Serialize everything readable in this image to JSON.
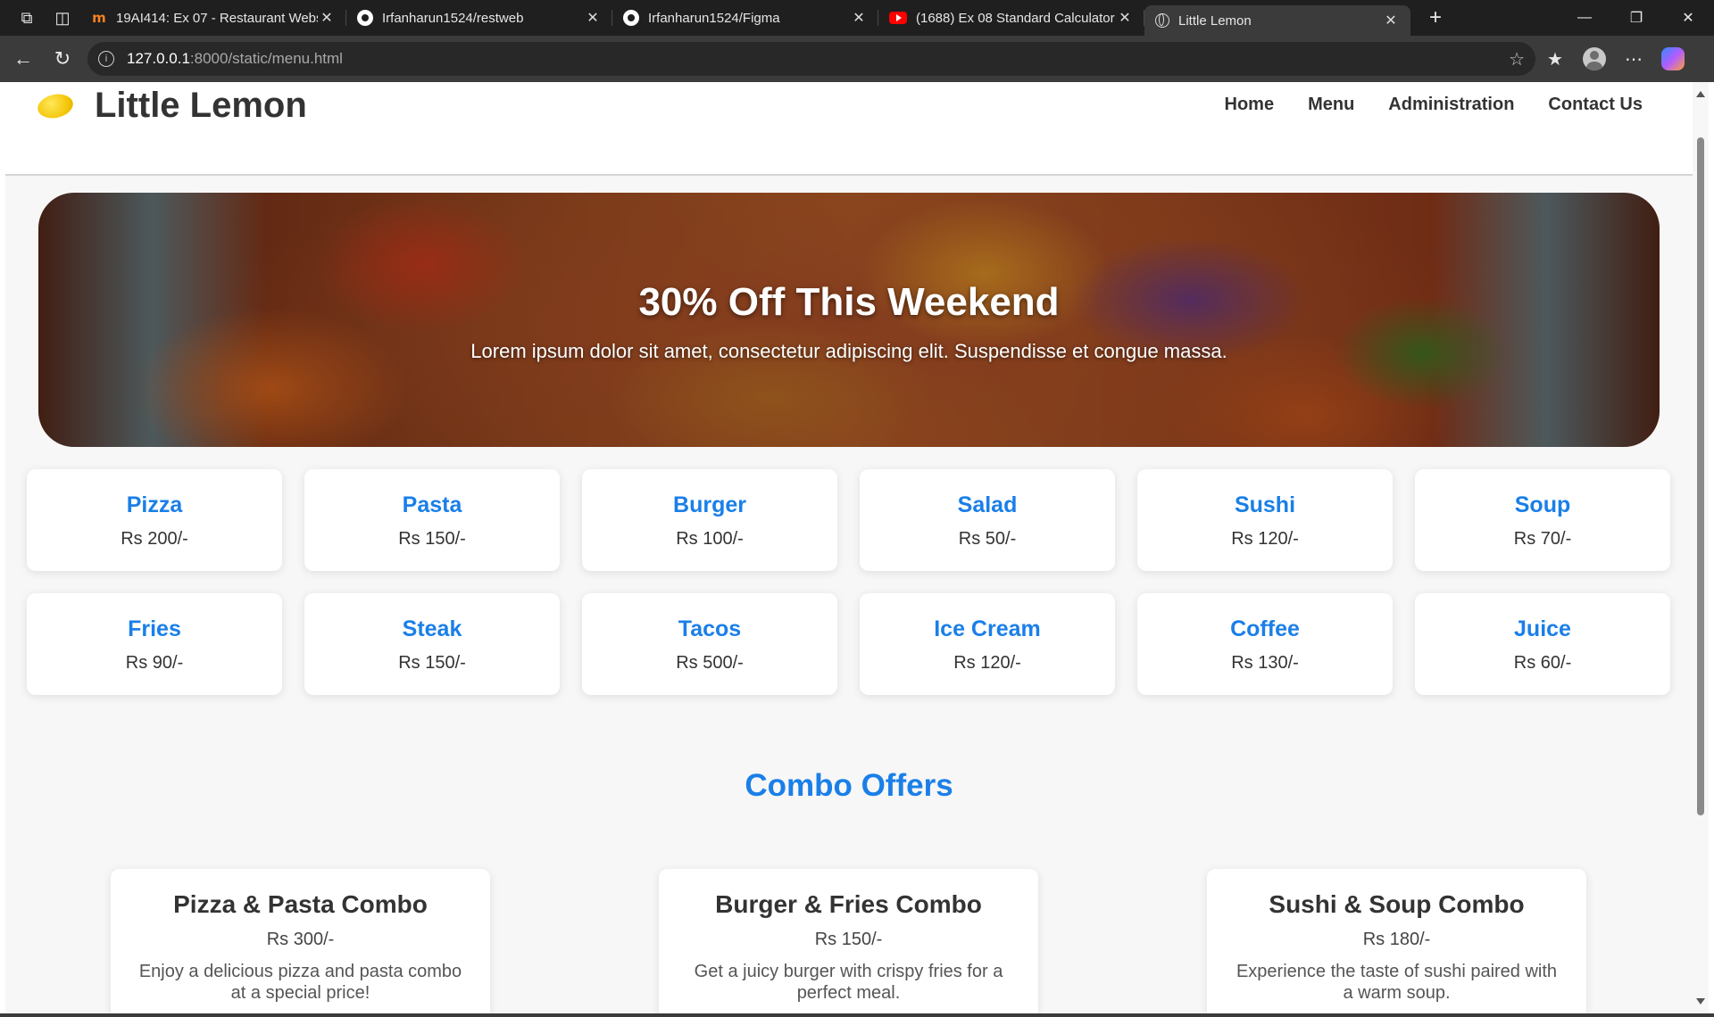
{
  "browser": {
    "tabs": [
      {
        "title": "19AI414: Ex 07 - Restaurant Webs",
        "favicon": "moodle-icon",
        "active": false
      },
      {
        "title": "Irfanharun1524/restweb",
        "favicon": "github-icon",
        "active": false
      },
      {
        "title": "Irfanharun1524/Figma",
        "favicon": "github-icon",
        "active": false
      },
      {
        "title": "(1688) Ex 08 Standard Calculator",
        "favicon": "youtube-icon",
        "active": false
      },
      {
        "title": "Little Lemon",
        "favicon": "globe-icon",
        "active": true
      }
    ],
    "url": {
      "host": "127.0.0.1",
      "rest": ":8000/static/menu.html"
    }
  },
  "site": {
    "title": "Little Lemon",
    "nav": [
      "Home",
      "Menu",
      "Administration",
      "Contact Us"
    ]
  },
  "hero": {
    "title": "30% Off This Weekend",
    "subtitle": "Lorem ipsum dolor sit amet, consectetur adipiscing elit. Suspendisse et congue massa."
  },
  "menu_items": [
    {
      "name": "Pizza",
      "price": "Rs 200/-"
    },
    {
      "name": "Pasta",
      "price": "Rs 150/-"
    },
    {
      "name": "Burger",
      "price": "Rs 100/-"
    },
    {
      "name": "Salad",
      "price": "Rs 50/-"
    },
    {
      "name": "Sushi",
      "price": "Rs 120/-"
    },
    {
      "name": "Soup",
      "price": "Rs 70/-"
    },
    {
      "name": "Fries",
      "price": "Rs 90/-"
    },
    {
      "name": "Steak",
      "price": "Rs 150/-"
    },
    {
      "name": "Tacos",
      "price": "Rs 500/-"
    },
    {
      "name": "Ice Cream",
      "price": "Rs 120/-"
    },
    {
      "name": "Coffee",
      "price": "Rs 130/-"
    },
    {
      "name": "Juice",
      "price": "Rs 60/-"
    }
  ],
  "combos": {
    "heading": "Combo Offers",
    "items": [
      {
        "name": "Pizza & Pasta Combo",
        "price": "Rs 300/-",
        "description": "Enjoy a delicious pizza and pasta combo at a special price!"
      },
      {
        "name": "Burger & Fries Combo",
        "price": "Rs 150/-",
        "description": "Get a juicy burger with crispy fries for a perfect meal."
      },
      {
        "name": "Sushi & Soup Combo",
        "price": "Rs 180/-",
        "description": "Experience the taste of sushi paired with a warm soup."
      }
    ]
  },
  "colors": {
    "accent": "#1a7fe8",
    "text": "#333333",
    "page_bg": "#f7f7f7"
  }
}
